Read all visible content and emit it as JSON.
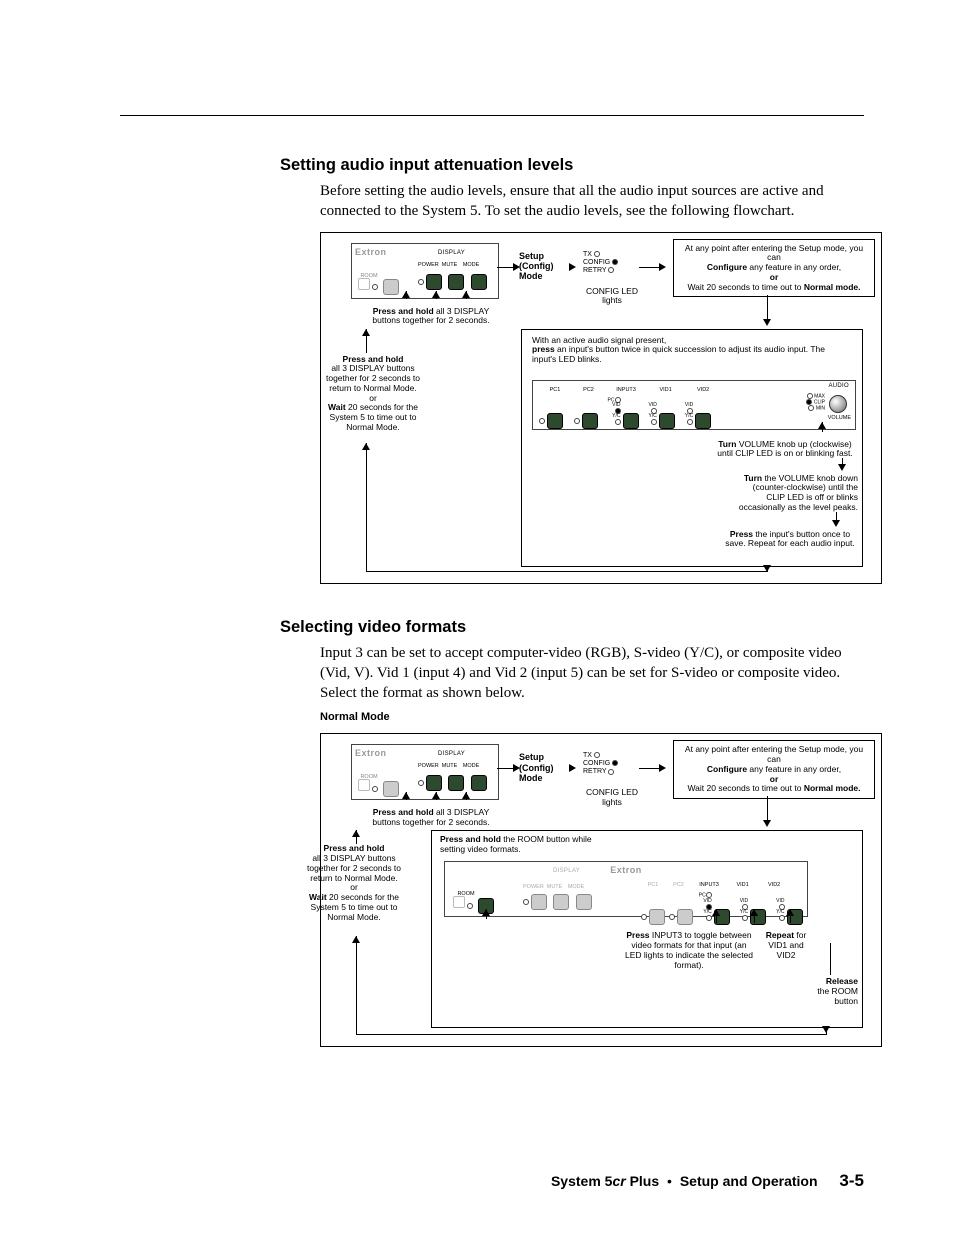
{
  "sections": {
    "audio": {
      "heading": "Setting audio input attenuation levels",
      "body": "Before setting the audio levels, ensure that all the audio input sources are active and connected to the System 5.  To set the audio levels, see the following flowchart."
    },
    "video": {
      "heading": "Selecting video formats",
      "body": "Input 3 can be set to accept computer-video (RGB), S-video (Y/C), or composite video (Vid, V).  Vid 1 (input 4) and Vid 2 (input 5) can be set for S-video or composite video.  Select the format as shown below.",
      "mode_label": "Normal Mode"
    }
  },
  "flow_common": {
    "brand": "Extron",
    "display_group": "DISPLAY",
    "btn_labels": [
      "POWER",
      "MUTE",
      "MODE"
    ],
    "room_label": "ROOM",
    "press_hold_all3_a": "Press and hold",
    "press_hold_all3_b": "all 3 DISPLAY buttons together for 2 seconds.",
    "setup_line1": "Setup",
    "setup_line2": "(Config)",
    "setup_line3": "Mode",
    "tx": "TX",
    "config": "CONFIG",
    "retry": "RETRY",
    "config_led": "CONFIG LED lights",
    "anypoint_1": "At any point after entering the Setup mode, you can",
    "anypoint_2a": "Configure",
    "anypoint_2b": " any feature in any order,",
    "anypoint_or": "or",
    "anypoint_3": "Wait 20 seconds to time out to ",
    "anypoint_3b": "Normal mode.",
    "return_block_a": "Press and hold",
    "return_block_b": "all 3 DISPLAY buttons together for 2 seconds to return to Normal Mode.",
    "return_or": "or",
    "return_wait_a": "Wait",
    "return_wait_b": " 20 seconds for the System 5 to time out to Normal Mode."
  },
  "flow_audio": {
    "active_1": "With an active audio signal present,",
    "active_2a": "press",
    "active_2b": " an input's button twice in quick succession to adjust its audio input.  The input's LED blinks.",
    "inputs": [
      "PC1",
      "PC2",
      "INPUT3",
      "VID1",
      "VID2"
    ],
    "sub_rows": [
      "PC",
      "VID",
      "Y/C"
    ],
    "audio_group": "AUDIO",
    "audio_leds": [
      "MAX",
      "CLIP",
      "MIN"
    ],
    "volume_label": "VOLUME",
    "turn_up_a": "Turn",
    "turn_up_b": " VOLUME knob up (clockwise) until CLIP LED is on or blinking fast.",
    "turn_down_a": "Turn",
    "turn_down_b": " the VOLUME knob down (counter-clockwise) until the CLIP LED is off or blinks occasionally as the level peaks.",
    "press_save_a": "Press",
    "press_save_b": " the input's button once to save. Repeat for each audio input."
  },
  "flow_video": {
    "hold_room_a": "Press and hold",
    "hold_room_b": " the ROOM button while setting video formats.",
    "inputs": [
      "PC1",
      "PC2",
      "INPUT3",
      "VID1",
      "VID2"
    ],
    "sub_rows": [
      "PC",
      "VID",
      "Y/C"
    ],
    "press_in3_a": "Press",
    "press_in3_b": " INPUT3 to toggle between video formats for that input (an LED lights to indicate the selected format).",
    "repeat_a": "Repeat",
    "repeat_b": " for VID1 and VID2",
    "release_a": "Release",
    "release_b": "the ROOM button",
    "return_block_b_short": "all 3 DISPLAY buttons together for 2 seconds to return to Normal Mode."
  },
  "footer": {
    "product": "System 5",
    "sigma": "cr",
    "plus": " Plus",
    "section": "Setup and Operation",
    "page": "3-5"
  }
}
